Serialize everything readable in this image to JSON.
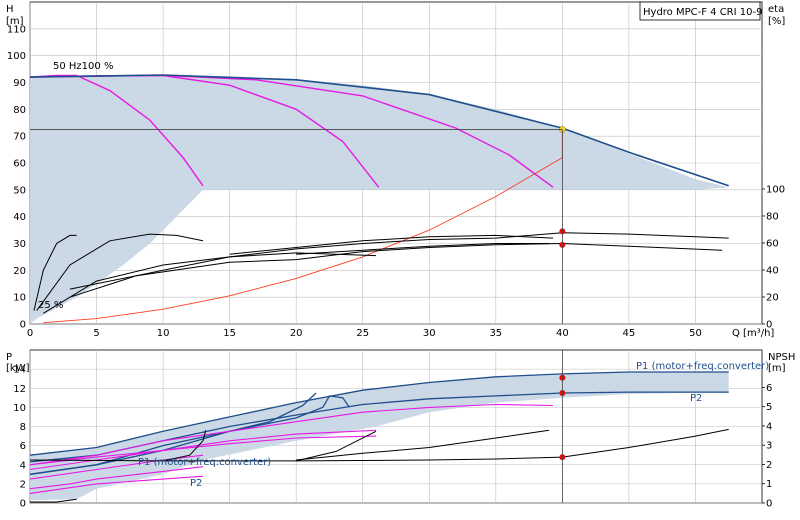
{
  "colors": {
    "envelope_fill": "#c8d6e5",
    "envelope_edge": "#1f4e8c",
    "speed_curve": "#e619e6",
    "efficiency_curve": "#000000",
    "system_curve": "#ff3c1e",
    "duty_point": "#ffd21e",
    "marker": "#ff0000",
    "grid": "#bfbfbf"
  },
  "chart_data": [
    {
      "type": "line",
      "title": "Hydro MPC-F 4 CRI 10-9",
      "ylabel_left": "H",
      "ylabel_left_unit": "[m]",
      "ylabel_right": "eta",
      "ylabel_right_unit": "[%]",
      "xlabel": "Q [m³/h]",
      "xlim": [
        0,
        55
      ],
      "ylim": [
        0,
        120
      ],
      "xticks": [
        0,
        5,
        10,
        15,
        20,
        25,
        30,
        35,
        40,
        45,
        50
      ],
      "yticks": [
        0,
        10,
        20,
        30,
        40,
        50,
        60,
        70,
        80,
        90,
        100,
        110
      ],
      "right_ticks": [
        0,
        20,
        40,
        60,
        80,
        100
      ],
      "grid": true,
      "annotations": {
        "top_speed": "50 Hz100 %",
        "min_speed": "25 %"
      },
      "duty_point": {
        "x": 40,
        "y": 72.5
      },
      "envelope": {
        "upper": [
          [
            0,
            92
          ],
          [
            5,
            92.5
          ],
          [
            10,
            92.8
          ],
          [
            15,
            92.3
          ],
          [
            20,
            91
          ],
          [
            25,
            89
          ],
          [
            30,
            85.5
          ],
          [
            35,
            80
          ],
          [
            40,
            73
          ],
          [
            45,
            63.5
          ],
          [
            50,
            54
          ],
          [
            52.5,
            51
          ]
        ],
        "lower": [
          [
            52.5,
            51
          ],
          [
            50,
            50
          ],
          [
            45,
            50
          ],
          [
            40,
            50
          ],
          [
            35,
            50
          ],
          [
            30,
            50
          ],
          [
            25,
            50
          ],
          [
            20,
            50
          ],
          [
            14,
            50
          ],
          [
            13,
            50
          ],
          [
            11,
            40
          ],
          [
            9,
            30
          ],
          [
            7,
            22
          ],
          [
            5,
            15
          ],
          [
            3.5,
            10
          ],
          [
            2,
            6
          ],
          [
            0.5,
            2
          ],
          [
            0,
            0
          ]
        ]
      },
      "series": [
        {
          "role": "pump-curve-1",
          "points": [
            [
              0,
              92
            ],
            [
              2,
              92.6
            ],
            [
              3.5,
              92.6
            ],
            [
              6,
              87
            ],
            [
              9,
              76
            ],
            [
              11.5,
              62
            ],
            [
              13,
              51.5
            ]
          ]
        },
        {
          "role": "pump-curve-2",
          "points": [
            [
              0,
              92
            ],
            [
              5,
              92.5
            ],
            [
              10,
              92.6
            ],
            [
              15,
              89
            ],
            [
              20,
              80
            ],
            [
              23.5,
              68
            ],
            [
              26.2,
              51
            ]
          ]
        },
        {
          "role": "pump-curve-3",
          "points": [
            [
              0,
              92
            ],
            [
              10,
              92.7
            ],
            [
              17,
              91
            ],
            [
              25,
              85
            ],
            [
              32,
              73
            ],
            [
              36,
              63
            ],
            [
              39.3,
              51
            ]
          ]
        },
        {
          "role": "pump-curve-4",
          "points": [
            [
              0,
              92
            ],
            [
              10,
              92.8
            ],
            [
              20,
              91
            ],
            [
              30,
              85.5
            ],
            [
              40,
              73
            ],
            [
              45,
              64
            ],
            [
              52.5,
              51.5
            ]
          ]
        },
        {
          "role": "system-curve",
          "points": [
            [
              1,
              0.5
            ],
            [
              5,
              2
            ],
            [
              10,
              5.5
            ],
            [
              15,
              10.5
            ],
            [
              20,
              17
            ],
            [
              25,
              25
            ],
            [
              30,
              35
            ],
            [
              35,
              47.5
            ],
            [
              40,
              62
            ],
            [
              40,
              72.5
            ]
          ]
        },
        {
          "role": "efficiency-1",
          "points": [
            [
              0.3,
              5
            ],
            [
              1,
              20
            ],
            [
              2,
              30
            ],
            [
              3,
              33
            ],
            [
              3.5,
              33
            ]
          ]
        },
        {
          "role": "efficiency-2",
          "points": [
            [
              0.5,
              5
            ],
            [
              3,
              22
            ],
            [
              6,
              31
            ],
            [
              9,
              33.5
            ],
            [
              11,
              33
            ],
            [
              13,
              31
            ]
          ]
        },
        {
          "role": "efficiency-3",
          "points": [
            [
              1,
              4
            ],
            [
              5,
              16
            ],
            [
              10,
              22
            ],
            [
              15,
              25
            ],
            [
              20,
              26.5
            ],
            [
              26,
              25.5
            ]
          ]
        },
        {
          "role": "efficiency-4",
          "points": [
            [
              3,
              10
            ],
            [
              8,
              18
            ],
            [
              15,
              23
            ],
            [
              20,
              24
            ],
            [
              25,
              27
            ],
            [
              30,
              28.5
            ],
            [
              35,
              29.5
            ],
            [
              40,
              30
            ],
            [
              45,
              29
            ],
            [
              52,
              27.5
            ]
          ]
        },
        {
          "role": "efficiency-5",
          "points": [
            [
              3,
              13
            ],
            [
              10,
              20
            ],
            [
              15,
              25
            ],
            [
              20,
              28
            ],
            [
              25,
              30
            ],
            [
              30,
              31.5
            ],
            [
              35,
              32
            ],
            [
              40,
              34
            ],
            [
              45,
              33.5
            ],
            [
              50,
              32.5
            ],
            [
              52.5,
              32
            ]
          ]
        },
        {
          "role": "efficiency-6",
          "points": [
            [
              15,
              26
            ],
            [
              20,
              28.5
            ],
            [
              25,
              31
            ],
            [
              30,
              32.5
            ],
            [
              35,
              33
            ],
            [
              39.3,
              32
            ]
          ]
        },
        {
          "role": "efficiency-7",
          "points": [
            [
              20,
              26
            ],
            [
              25,
              27.5
            ],
            [
              30,
              29
            ],
            [
              35,
              30
            ],
            [
              39,
              30
            ]
          ]
        }
      ],
      "markers": [
        [
          40,
          72.5
        ],
        [
          40,
          34.5
        ],
        [
          40,
          29.5
        ]
      ]
    },
    {
      "type": "line",
      "ylabel_left": "P",
      "ylabel_left_unit": "[kW]",
      "ylabel_right": "NPSH",
      "ylabel_right_unit": "[m]",
      "xlim": [
        0,
        55
      ],
      "ylim": [
        0,
        16
      ],
      "yticks": [
        0,
        2,
        4,
        6,
        8,
        10,
        12,
        14
      ],
      "right_ticks": [
        0,
        1,
        2,
        3,
        4,
        5,
        6
      ],
      "grid": true,
      "series_labels": {
        "p1_upper": "P1 (motor+freq.converter)",
        "p2_upper": "P2",
        "p1_lower": "P1 (motor+freq.converter)",
        "p2_lower": "P2"
      },
      "envelope": {
        "upper": [
          [
            0,
            5
          ],
          [
            5,
            5.8
          ],
          [
            10,
            7.5
          ],
          [
            15,
            9
          ],
          [
            20,
            10.5
          ],
          [
            25,
            11.8
          ],
          [
            30,
            12.6
          ],
          [
            35,
            13.2
          ],
          [
            40,
            13.5
          ],
          [
            45,
            13.7
          ],
          [
            52.5,
            13.7
          ]
        ],
        "lower": [
          [
            52.5,
            11.6
          ],
          [
            45,
            11.4
          ],
          [
            40,
            11
          ],
          [
            35,
            10.5
          ],
          [
            30,
            9.5
          ],
          [
            26,
            8
          ],
          [
            20,
            6.5
          ],
          [
            13,
            4.5
          ],
          [
            10,
            3
          ],
          [
            5,
            1.5
          ],
          [
            3.5,
            0.4
          ],
          [
            0,
            0.3
          ]
        ]
      },
      "series": [
        {
          "role": "p1-max",
          "points": [
            [
              0,
              5
            ],
            [
              5,
              5.8
            ],
            [
              10,
              7.5
            ],
            [
              15,
              9
            ],
            [
              20,
              10.5
            ],
            [
              25,
              11.8
            ],
            [
              30,
              12.6
            ],
            [
              35,
              13.2
            ],
            [
              40,
              13.5
            ],
            [
              45,
              13.7
            ],
            [
              52.5,
              13.7
            ]
          ]
        },
        {
          "role": "p2-max",
          "points": [
            [
              0,
              4.3
            ],
            [
              5,
              5
            ],
            [
              10,
              6.5
            ],
            [
              15,
              8
            ],
            [
              20,
              9.2
            ],
            [
              25,
              10.3
            ],
            [
              30,
              10.9
            ],
            [
              35,
              11.2
            ],
            [
              40,
              11.5
            ],
            [
              45,
              11.6
            ],
            [
              52.5,
              11.6
            ]
          ]
        },
        {
          "role": "p1-speed-a",
          "points": [
            [
              0,
              3
            ],
            [
              5,
              4
            ],
            [
              10,
              5.5
            ],
            [
              15,
              7.5
            ],
            [
              20,
              8.9
            ],
            [
              22,
              10
            ],
            [
              22.5,
              11.2
            ],
            [
              23.5,
              11
            ],
            [
              24,
              10
            ]
          ]
        },
        {
          "role": "p1-speed-b",
          "points": [
            [
              0,
              3
            ],
            [
              5,
              4
            ],
            [
              10,
              6
            ],
            [
              15,
              7.5
            ],
            [
              18,
              8.5
            ],
            [
              20.5,
              10.2
            ],
            [
              21.5,
              11.5
            ]
          ]
        },
        {
          "role": "p-magenta-1",
          "points": [
            [
              0,
              4
            ],
            [
              5,
              5
            ],
            [
              10,
              6.5
            ],
            [
              15,
              7.5
            ],
            [
              20,
              8.5
            ],
            [
              25,
              9.5
            ],
            [
              30,
              10
            ],
            [
              35,
              10.3
            ],
            [
              39.3,
              10.2
            ]
          ]
        },
        {
          "role": "p-magenta-2",
          "points": [
            [
              0,
              3.5
            ],
            [
              5,
              4.5
            ],
            [
              10,
              5.5
            ],
            [
              15,
              6.5
            ],
            [
              20,
              7.2
            ],
            [
              26,
              7.6
            ]
          ]
        },
        {
          "role": "p-magenta-3",
          "points": [
            [
              0,
              2.5
            ],
            [
              5,
              3.5
            ],
            [
              10,
              4.5
            ],
            [
              13,
              5
            ]
          ]
        },
        {
          "role": "p-magenta-4",
          "points": [
            [
              0,
              1.5
            ],
            [
              3,
              2
            ],
            [
              5,
              2.5
            ],
            [
              10,
              3.3
            ],
            [
              13,
              3.8
            ]
          ]
        },
        {
          "role": "p-magenta-5",
          "points": [
            [
              0,
              1
            ],
            [
              3,
              1.6
            ],
            [
              5,
              2
            ],
            [
              10,
              2.5
            ],
            [
              13,
              2.8
            ]
          ]
        },
        {
          "role": "p-magenta-6",
          "points": [
            [
              0,
              4
            ],
            [
              5,
              4.8
            ],
            [
              10,
              5.5
            ],
            [
              15,
              6.2
            ],
            [
              20,
              6.8
            ],
            [
              26,
              7
            ]
          ]
        },
        {
          "role": "npsh-1",
          "points": [
            [
              0,
              4.5
            ],
            [
              10,
              4.4
            ],
            [
              20,
              4.4
            ],
            [
              30,
              4.5
            ],
            [
              35,
              4.6
            ],
            [
              40,
              4.8
            ],
            [
              45,
              5.8
            ],
            [
              50,
              7
            ],
            [
              52.5,
              7.7
            ]
          ]
        },
        {
          "role": "npsh-2",
          "points": [
            [
              20,
              4.5
            ],
            [
              25,
              5.2
            ],
            [
              30,
              5.8
            ],
            [
              35,
              6.8
            ],
            [
              39,
              7.6
            ]
          ]
        },
        {
          "role": "npsh-3",
          "points": [
            [
              20,
              4.4
            ],
            [
              23,
              5.4
            ],
            [
              26,
              7.5
            ]
          ]
        },
        {
          "role": "npsh-4",
          "points": [
            [
              10,
              4.4
            ],
            [
              12,
              5
            ],
            [
              13,
              6.5
            ],
            [
              13.2,
              7.6
            ]
          ]
        },
        {
          "role": "npsh-5",
          "points": [
            [
              0,
              0.1
            ],
            [
              2,
              0.1
            ],
            [
              3.5,
              0.4
            ]
          ]
        }
      ],
      "markers": [
        [
          40,
          13.1
        ],
        [
          40,
          11.5
        ],
        [
          40,
          4.8
        ]
      ]
    }
  ]
}
